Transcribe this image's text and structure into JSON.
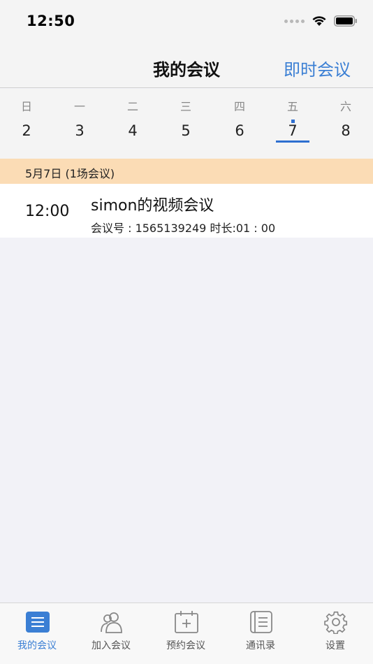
{
  "status_bar": {
    "time": "12:50"
  },
  "nav": {
    "title": "我的会议",
    "action": "即时会议"
  },
  "week": {
    "days": [
      {
        "name": "日",
        "num": "2"
      },
      {
        "name": "一",
        "num": "3"
      },
      {
        "name": "二",
        "num": "4"
      },
      {
        "name": "三",
        "num": "5"
      },
      {
        "name": "四",
        "num": "6"
      },
      {
        "name": "五",
        "num": "7"
      },
      {
        "name": "六",
        "num": "8"
      }
    ],
    "selected_index": 5
  },
  "date_header": "5月7日 (1场会议)",
  "meeting": {
    "time": "12:00",
    "title": "simon的视频会议",
    "subtitle": "会议号 : 1565139249 时长:01 : 00"
  },
  "tabs": [
    {
      "label": "我的会议",
      "icon": "list-icon",
      "active": true
    },
    {
      "label": "加入会议",
      "icon": "people-icon",
      "active": false
    },
    {
      "label": "预约会议",
      "icon": "calendar-add-icon",
      "active": false
    },
    {
      "label": "通讯录",
      "icon": "contacts-icon",
      "active": false
    },
    {
      "label": "设置",
      "icon": "gear-icon",
      "active": false
    }
  ],
  "colors": {
    "accent": "#3b7fd4",
    "header_bg": "#fbdcb5",
    "selected_day": "#2e6fd0"
  }
}
